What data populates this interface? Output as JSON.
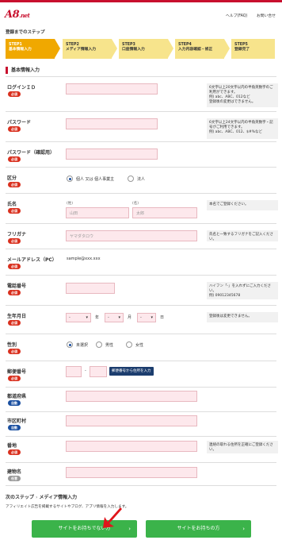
{
  "header": {
    "logo_main": "A8",
    "logo_sub": ".net",
    "links": [
      "ヘルプ(FAQ)",
      "お問い合せ"
    ]
  },
  "steps_title": "登録までのステップ",
  "steps": [
    {
      "line1": "STEP1",
      "line2": "基本情報入力",
      "active": true
    },
    {
      "line1": "STEP2",
      "line2": "メディア情報入力",
      "active": false
    },
    {
      "line1": "STEP3",
      "line2": "口座情報入力",
      "active": false
    },
    {
      "line1": "STEP4",
      "line2": "入力内容確認・修正",
      "active": false
    },
    {
      "line1": "STEP5",
      "line2": "登録完了",
      "active": false
    }
  ],
  "section_title": "基本情報入力",
  "badges": {
    "required": "必須",
    "auto": "自動",
    "optional": "任意"
  },
  "fields": {
    "login_id": {
      "label": "ログインＩＤ",
      "note": "6文字以上20文字以内の半角英数字のご利用ができます。\n例) abc、ABC、012など\n登録後の変更はできません。"
    },
    "password": {
      "label": "パスワード",
      "note": "6文字以上24文字以内の半角英数字・記号がご利用できます。\n例) abc、ABC、012、$#%など"
    },
    "password_confirm": {
      "label": "パスワード（確認用）"
    },
    "category": {
      "label": "区分",
      "options": [
        "個人 又は 個人事業主",
        "法人"
      ],
      "selected": 0
    },
    "name": {
      "label": "氏名",
      "sub_last": "(姓)",
      "sub_first": "(名)",
      "ph_last": "山田",
      "ph_first": "太郎",
      "note": "本名でご登録ください。"
    },
    "furigana": {
      "label": "フリガナ",
      "placeholder": "ヤマダタロウ",
      "note": "氏名と一致するフリガナをご記入ください。"
    },
    "email": {
      "label": "メールアドレス（PC）",
      "value": "sample@xxx.xxx"
    },
    "phone": {
      "label": "電話番号",
      "note": "ハイフン「-」を入れずにご入力ください。\n例) 0901234567​8"
    },
    "birthday": {
      "label": "生年月日",
      "year_unit": "年",
      "month_unit": "月",
      "day_unit": "日",
      "dash": "-",
      "note": "登録後は変更できません。"
    },
    "gender": {
      "label": "性別",
      "options": [
        "未選択",
        "男性",
        "女性"
      ],
      "selected": 0
    },
    "postal": {
      "label": "郵便番号",
      "sep": "-",
      "button": "郵便番号から住所を入力"
    },
    "prefecture": {
      "label": "都道府県"
    },
    "city": {
      "label": "市区町村"
    },
    "address": {
      "label": "番地",
      "note": "連絡の取れる住所を正確にご登録ください。"
    },
    "building": {
      "label": "建物名"
    }
  },
  "next": {
    "title_a": "次のステップ",
    "title_b": "メディア情報入力",
    "desc": "アフィリエイト広告を掲載するサイトやブログ、アプリ情報を入力します。",
    "btn_no_site": "サイトをお持ちでない方",
    "btn_has_site": "サイトをお持ちの方"
  },
  "colors": {
    "brand": "#c8102e",
    "step_active": "#f0a800",
    "step": "#f7e48c",
    "green": "#3bb34a",
    "cursor": "#e0151b"
  }
}
